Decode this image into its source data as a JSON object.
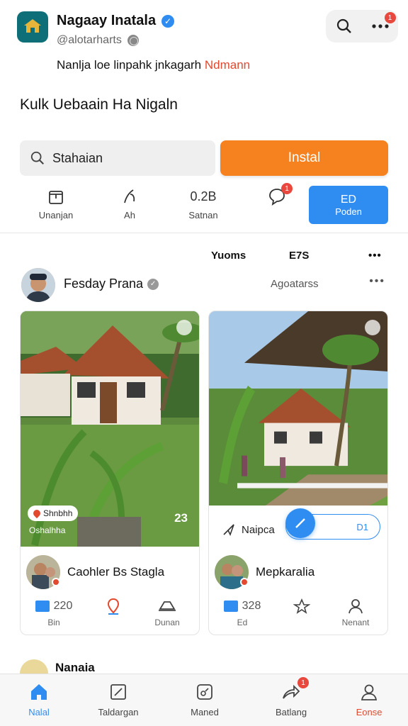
{
  "header": {
    "app_title": "Nagaay Inatala",
    "handle": "@alotarharts",
    "logo_icon": "temple-logo-icon",
    "search_icon": "search-icon",
    "more_icon": "more-horizontal-icon",
    "notification_badge": "1"
  },
  "tagline": {
    "text": "Nanlja loe linpahk jnkagarh",
    "accent": "Ndmann"
  },
  "heading": "Kulk Uebaain Ha Nigaln",
  "search": {
    "value": "Stahaian"
  },
  "install_label": "Instal",
  "actions": [
    {
      "label": "Unanjan",
      "icon": "box-icon"
    },
    {
      "label": "Ah",
      "icon": "leaf-icon"
    },
    {
      "label": "Satnan",
      "value": "0.2B"
    },
    {
      "label": "",
      "icon": "chat-bubble-icon",
      "badge": "1"
    },
    {
      "label": "Poden",
      "value": "ED"
    }
  ],
  "feed": {
    "top_left": "Yuoms",
    "top_mid": "E7S",
    "author": "Fesday Prana",
    "category": "Agoatarss",
    "next_post_title": "Nanaia"
  },
  "cards": [
    {
      "location_chip": "Shnbhh",
      "image_caption": "Oshalhha",
      "image_count": "23",
      "user_name": "Caohler Bs Stagla",
      "stats": [
        {
          "value": "220",
          "label": "Bin"
        },
        {
          "value": "",
          "label": ""
        },
        {
          "value": "",
          "label": "Dunan"
        }
      ]
    },
    {
      "strip_label": "Naipca",
      "pill_value": "D1",
      "user_name": "Mepkaralia",
      "stats": [
        {
          "value": "328",
          "label": "Ed"
        },
        {
          "value": "",
          "label": ""
        },
        {
          "value": "",
          "label": "Nenant"
        }
      ]
    }
  ],
  "bottom_nav": [
    {
      "label": "Nalal",
      "icon": "home-icon",
      "active": true
    },
    {
      "label": "Taldargan",
      "icon": "edit-box-icon"
    },
    {
      "label": "Maned",
      "icon": "map-square-icon"
    },
    {
      "label": "Batlang",
      "icon": "share-icon",
      "badge": "1"
    },
    {
      "label": "Eonse",
      "icon": "profile-icon"
    }
  ],
  "colors": {
    "accent_orange": "#f5821f",
    "accent_blue": "#2f8df2",
    "accent_red": "#e2492f",
    "logo_teal": "#0f6f78"
  }
}
